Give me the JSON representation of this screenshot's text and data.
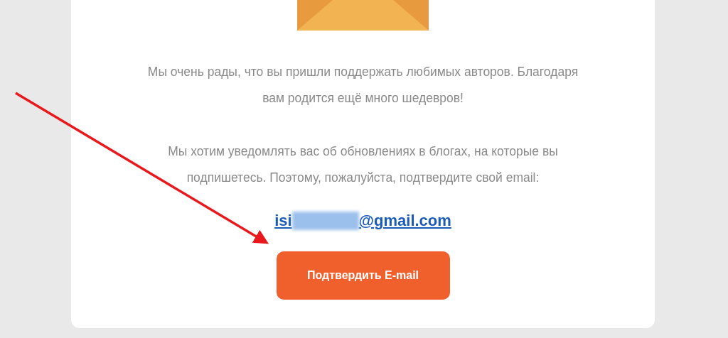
{
  "paragraphs": [
    "Мы очень рады, что вы пришли поддержать любимых авторов. Благодаря вам родится ещё много шедевров!",
    "Мы хотим уведомлять вас об обновлениях в блогах, на которые вы подпишетесь. Поэтому, пожалуйста, подтвердите свой email:"
  ],
  "email": {
    "prefix": "isi",
    "suffix": "@gmail.com",
    "redacted": true
  },
  "button": {
    "label": "Подтвердить E-mail"
  }
}
